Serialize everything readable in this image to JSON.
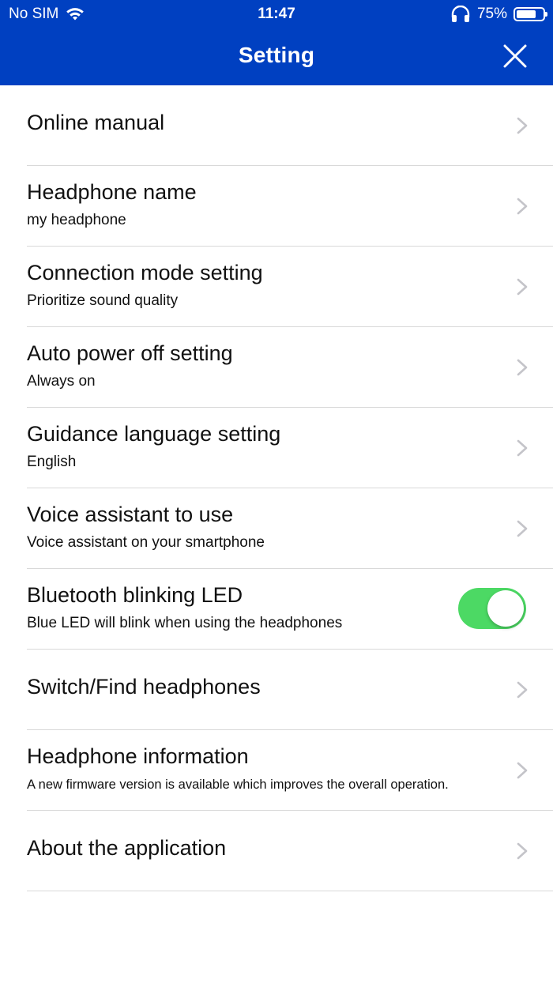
{
  "status_bar": {
    "carrier": "No SIM",
    "time": "11:47",
    "battery_percent": "75%",
    "battery_level": 0.75
  },
  "header": {
    "title": "Setting",
    "close_icon": "close-icon",
    "background_color": "#0040c1"
  },
  "settings": {
    "online_manual": {
      "title": "Online manual"
    },
    "headphone_name": {
      "title": "Headphone name",
      "value": "my headphone"
    },
    "connection_mode": {
      "title": "Connection mode setting",
      "value": "Prioritize sound quality"
    },
    "auto_power_off": {
      "title": "Auto power off setting",
      "value": "Always on"
    },
    "guidance_language": {
      "title": "Guidance language setting",
      "value": "English"
    },
    "voice_assistant": {
      "title": "Voice assistant to use",
      "value": "Voice assistant on your smartphone"
    },
    "bluetooth_led": {
      "title": "Bluetooth blinking LED",
      "value": "Blue LED will blink when using the headphones",
      "enabled": true,
      "toggle_color": "#4cd964"
    },
    "switch_find": {
      "title": "Switch/Find headphones"
    },
    "headphone_info": {
      "title": "Headphone information",
      "value": "A new firmware version is available which improves the overall operation."
    },
    "about": {
      "title": "About the application"
    }
  }
}
